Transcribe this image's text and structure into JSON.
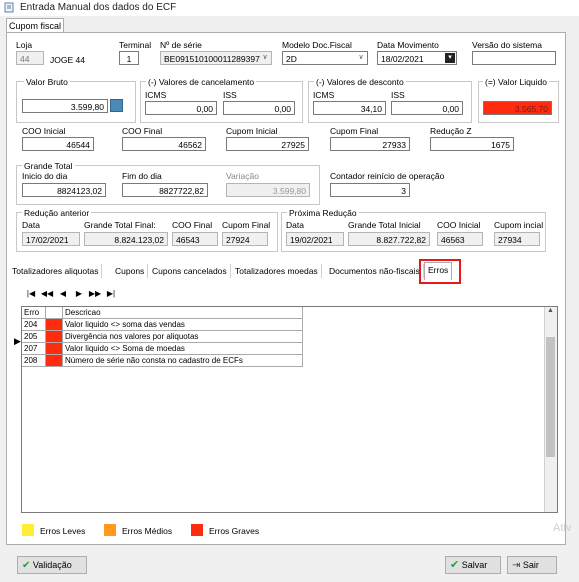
{
  "window": {
    "title": "Entrada Manual dos dados do ECF"
  },
  "top_tab": {
    "label": "Cupom fiscal"
  },
  "header": {
    "loja_label": "Loja",
    "loja_value": "44",
    "loja_name": "JOGE 44",
    "terminal_label": "Terminal",
    "terminal_value": "1",
    "serie_label": "Nº de série",
    "serie_value": "BE091510100011289397",
    "modelo_label": "Modelo Doc.Fiscal",
    "modelo_value": "2D",
    "data_mov_label": "Data Movimento",
    "data_mov_value": "18/02/2021",
    "versao_label": "Versão do sistema",
    "versao_value": ""
  },
  "valor_bruto": {
    "label": "Valor Bruto",
    "value": "3.599,80"
  },
  "cancelamento": {
    "label": "(-) Valores de cancelamento",
    "icms_label": "ICMS",
    "icms_value": "0,00",
    "iss_label": "ISS",
    "iss_value": "0,00"
  },
  "desconto": {
    "label": "(-) Valores de desconto",
    "icms_label": "ICMS",
    "icms_value": "34,10",
    "iss_label": "ISS",
    "iss_value": "0,00"
  },
  "liquido": {
    "label": "(=) Valor Liquido",
    "value": "3.565,70",
    "color": "#ff2b0f"
  },
  "coo": {
    "coo_inicial_label": "COO Inicial",
    "coo_inicial_value": "46544",
    "coo_final_label": "COO Final",
    "coo_final_value": "46562",
    "cupom_inicial_label": "Cupom Inicial",
    "cupom_inicial_value": "27925",
    "cupom_final_label": "Cupom Final",
    "cupom_final_value": "27933",
    "reducao_z_label": "Redução Z",
    "reducao_z_value": "1675"
  },
  "grande_total": {
    "label": "Grande Total",
    "inicio_label": "Inicio do dia",
    "inicio_value": "8824123,02",
    "fim_label": "Fim do dia",
    "fim_value": "8827722,82",
    "variacao_label": "Variação",
    "variacao_value": "3.599,80"
  },
  "contador": {
    "label": "Contador reinício de operação",
    "value": "3"
  },
  "reducao_anterior": {
    "label": "Redução anterior",
    "data_label": "Data",
    "data_value": "17/02/2021",
    "gt_label": "Grande Total Final:",
    "gt_value": "8.824.123,02",
    "coo_label": "COO Final",
    "coo_value": "46543",
    "cupom_label": "Cupom Final",
    "cupom_value": "27924"
  },
  "proxima_reducao": {
    "label": "Próxima Redução",
    "data_label": "Data",
    "data_value": "19/02/2021",
    "gt_label": "Grande Total Inicial",
    "gt_value": "8.827.722,82",
    "coo_label": "COO Inicial",
    "coo_value": "46563",
    "cupom_label": "Cupom incial",
    "cupom_value": "27934"
  },
  "tabs": [
    "Totalizadores aliquotas",
    "Cupons",
    "Cupons cancelados",
    "Totalizadores moedas",
    "Documentos não-fiscais",
    "Erros"
  ],
  "nav": [
    "|◀",
    "◀◀",
    "◀",
    "▶",
    "▶▶",
    "▶|"
  ],
  "grid": {
    "columns": [
      "Erro",
      "",
      "Descricao"
    ],
    "rows": [
      {
        "erro": "204",
        "descricao": "Valor liquido <> soma das vendas",
        "color": "#ff2b0f"
      },
      {
        "erro": "205",
        "descricao": "Divergência nos valores por aliquotas",
        "color": "#ff2b0f"
      },
      {
        "erro": "207",
        "descricao": "Valor liquido <> Soma de moedas",
        "color": "#ff2b0f"
      },
      {
        "erro": "208",
        "descricao": "Número de série não consta no cadastro de ECFs",
        "color": "#ff2b0f"
      }
    ]
  },
  "legend": [
    {
      "label": "Erros Leves",
      "color": "#ffee33"
    },
    {
      "label": "Erros Médios",
      "color": "#ff9a1f"
    },
    {
      "label": "Erros Graves",
      "color": "#ff2b0f"
    }
  ],
  "buttons": {
    "validacao": "Validação",
    "salvar": "Salvar",
    "sair": "Sair"
  },
  "watermark": "Ativ"
}
